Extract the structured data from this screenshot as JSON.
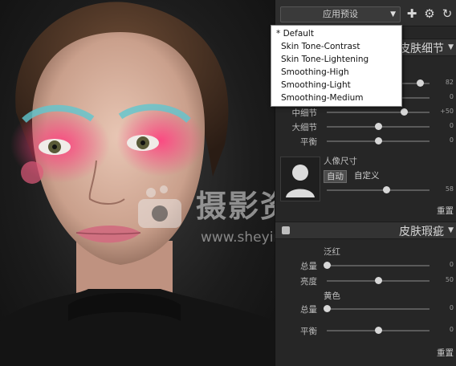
{
  "toolbar": {
    "preset_button_label": "应用预设",
    "add_icon": "plus-icon",
    "settings_icon": "gear-icon",
    "refresh_icon": "refresh-icon"
  },
  "preset_menu": {
    "options": [
      "* Default",
      "Skin Tone-Contrast",
      "Skin Tone-Lightening",
      "Smoothing-High",
      "Smoothing-Light",
      "Smoothing-Medium"
    ]
  },
  "skin_detail": {
    "title": "皮肤细节",
    "rows": [
      {
        "label": "",
        "value": "82",
        "level": 0.91
      },
      {
        "label": "",
        "value": "0",
        "level": 0.5
      },
      {
        "label": "中细节",
        "value": "+50",
        "level": 0.75
      },
      {
        "label": "大细节",
        "value": "0",
        "level": 0.5
      },
      {
        "label": "平衡",
        "value": "0",
        "level": 0.5
      }
    ]
  },
  "portrait_size": {
    "label": "人像尺寸",
    "auto_label": "自动",
    "custom_label": "自定义",
    "value": "58",
    "level": 0.58,
    "reset_label": "重置"
  },
  "skin_blemish": {
    "title": "皮肤瑕疵",
    "redness_label": "泛红",
    "redness_rows": [
      {
        "label": "总量",
        "value": "0",
        "level": 0.0
      },
      {
        "label": "亮度",
        "value": "50",
        "level": 0.5
      }
    ],
    "yellow_label": "黄色",
    "yellow_rows": [
      {
        "label": "总量",
        "value": "0",
        "level": 0.0
      }
    ],
    "balance_row": {
      "label": "平衡",
      "value": "0",
      "level": 0.5
    },
    "reset_label": "重置"
  },
  "watermark": {
    "cn": "摄影资源馆",
    "url": "www.sheyingzyg.com"
  },
  "colors": {
    "panel_bg": "#262626",
    "header_bg": "#333333",
    "makeup_pink": "#ff3f7f",
    "makeup_blue": "#5fc7d0"
  }
}
